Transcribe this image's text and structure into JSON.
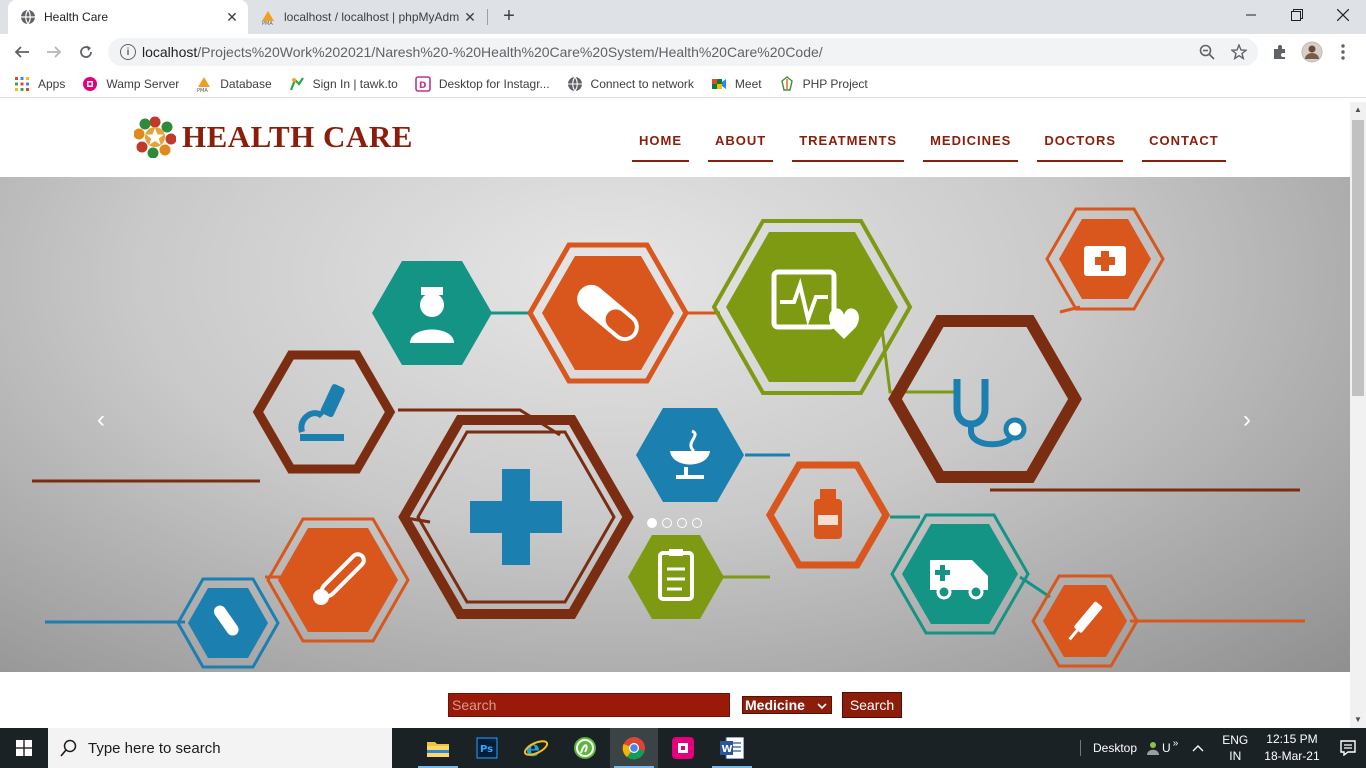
{
  "browser": {
    "tabs": [
      {
        "title": "Health Care",
        "active": true
      },
      {
        "title": "localhost / localhost | phpMyAdm",
        "active": false
      }
    ],
    "url_host": "localhost",
    "url_path": "/Projects%20Work%202021/Naresh%20-%20Health%20Care%20System/Health%20Care%20Code/",
    "bookmarks": [
      {
        "label": "Apps",
        "icon": "apps-grid-icon"
      },
      {
        "label": "Wamp Server",
        "icon": "wamp-icon"
      },
      {
        "label": "Database",
        "icon": "pma-icon"
      },
      {
        "label": "Sign In | tawk.to",
        "icon": "tawkto-icon"
      },
      {
        "label": "Desktop for Instagr...",
        "icon": "instagram-desktop-icon"
      },
      {
        "label": "Connect to network",
        "icon": "globe-icon"
      },
      {
        "label": "Meet",
        "icon": "meet-icon"
      },
      {
        "label": "PHP Project",
        "icon": "php-project-icon"
      }
    ]
  },
  "site": {
    "logo_text": "HEALTH CARE",
    "nav": [
      "HOME",
      "ABOUT",
      "TREATMENTS",
      "MEDICINES",
      "DOCTORS",
      "CONTACT"
    ],
    "slider": {
      "slides": 4,
      "active_slide": 1
    },
    "search": {
      "placeholder": "Search",
      "category": "Medicine",
      "button": "Search"
    },
    "colors": {
      "brand": "#8c1d0b",
      "teal": "#139484",
      "orange": "#d9561d",
      "green": "#7d9a12",
      "blue": "#1b7fb0",
      "brown": "#7a2d10"
    }
  },
  "taskbar": {
    "search_placeholder": "Type here to search",
    "desktop_label": "Desktop",
    "lang_top": "ENG",
    "lang_bottom": "IN",
    "time": "12:15 PM",
    "date": "18-Mar-21",
    "user_initial": "U"
  }
}
